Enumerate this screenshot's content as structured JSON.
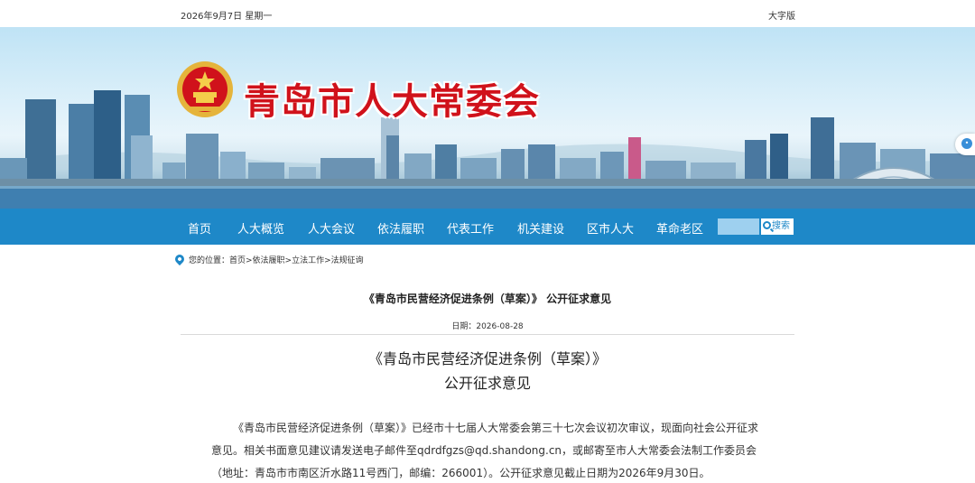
{
  "topbar": {
    "date": "2026年9月7日 星期一",
    "large_font": "大字版"
  },
  "site": {
    "title": "青岛市人大常委会"
  },
  "nav": {
    "items": [
      "首页",
      "人大概览",
      "人大会议",
      "依法履职",
      "代表工作",
      "机关建设",
      "区市人大",
      "革命老区"
    ],
    "search_button": "搜索",
    "search_placeholder": ""
  },
  "breadcrumb": {
    "label": "您的位置：",
    "path": "首页>依法履职>立法工作>法规征询"
  },
  "article": {
    "title": "《青岛市民营经济促进条例（草案）》 公开征求意见",
    "date": "日期：2026-08-28",
    "heading_line1": "《青岛市民营经济促进条例（草案）》",
    "heading_line2": "公开征求意见",
    "body": "《青岛市民营经济促进条例（草案）》已经市十七届人大常委会第三十七次会议初次审议，现面向社会公开征求意见。相关书面意见建议请发送电子邮件至qdrdfgzs@qd.shandong.cn，或邮寄至市人大常委会法制工作委员会（地址：青岛市市南区沂水路11号西门，邮编：266001）。公开征求意见截止日期为2026年9月30日。"
  },
  "colors": {
    "nav": "#1e88c8",
    "title_red": "#d0121b"
  }
}
